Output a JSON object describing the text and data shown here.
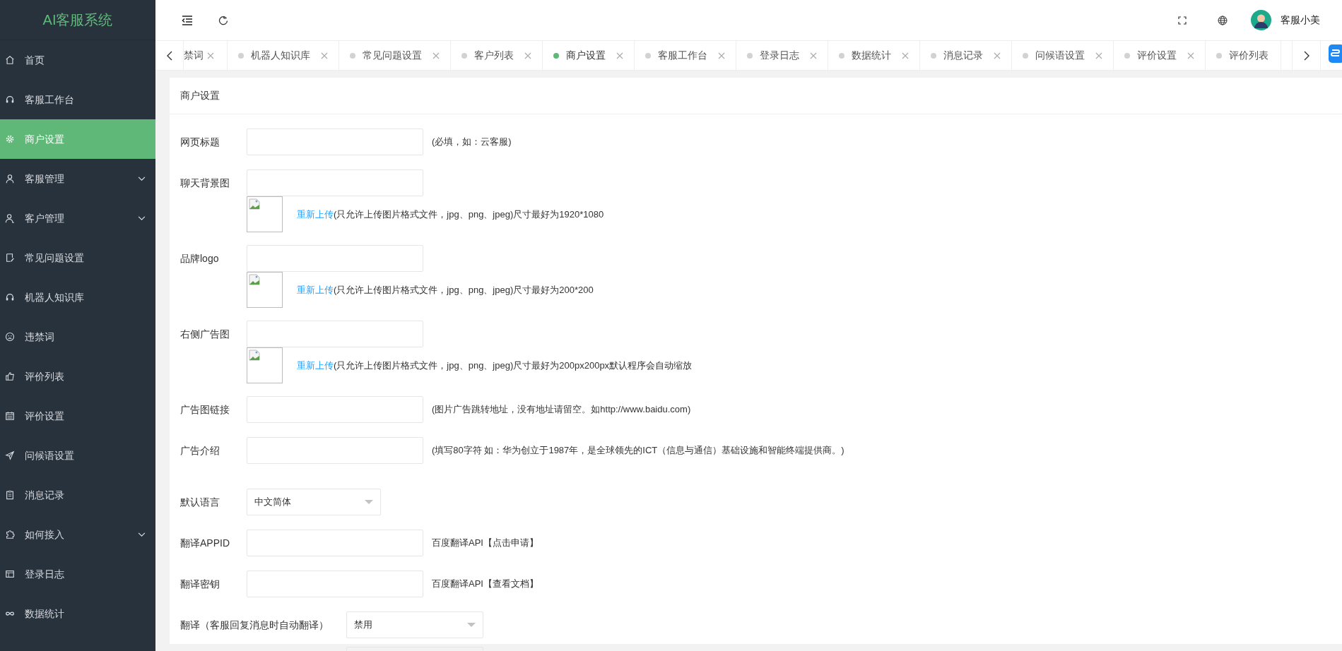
{
  "app_title": "AI客服系统",
  "sidebar": {
    "items": [
      {
        "label": "首页",
        "selected": false,
        "has_submenu": false
      },
      {
        "label": "客服工作台",
        "selected": false,
        "has_submenu": false
      },
      {
        "label": "商户设置",
        "selected": true,
        "has_submenu": false
      },
      {
        "label": "客服管理",
        "selected": false,
        "has_submenu": true
      },
      {
        "label": "客户管理",
        "selected": false,
        "has_submenu": true
      },
      {
        "label": "常见问题设置",
        "selected": false,
        "has_submenu": false
      },
      {
        "label": "机器人知识库",
        "selected": false,
        "has_submenu": false
      },
      {
        "label": "违禁词",
        "selected": false,
        "has_submenu": false
      },
      {
        "label": "评价列表",
        "selected": false,
        "has_submenu": false
      },
      {
        "label": "评价设置",
        "selected": false,
        "has_submenu": false
      },
      {
        "label": "问候语设置",
        "selected": false,
        "has_submenu": false
      },
      {
        "label": "消息记录",
        "selected": false,
        "has_submenu": false
      },
      {
        "label": "如何接入",
        "selected": false,
        "has_submenu": true
      },
      {
        "label": "登录日志",
        "selected": false,
        "has_submenu": false
      },
      {
        "label": "数据统计",
        "selected": false,
        "has_submenu": false
      }
    ]
  },
  "user": {
    "name": "客服小美"
  },
  "tabs": [
    {
      "label": "禁词",
      "selected": false,
      "closable": true,
      "cut": true
    },
    {
      "label": "机器人知识库",
      "selected": false,
      "closable": true,
      "cut": false
    },
    {
      "label": "常见问题设置",
      "selected": false,
      "closable": true,
      "cut": false
    },
    {
      "label": "客户列表",
      "selected": false,
      "closable": true,
      "cut": false
    },
    {
      "label": "商户设置",
      "selected": true,
      "closable": true,
      "cut": false
    },
    {
      "label": "客服工作台",
      "selected": false,
      "closable": true,
      "cut": false
    },
    {
      "label": "登录日志",
      "selected": false,
      "closable": true,
      "cut": false
    },
    {
      "label": "数据统计",
      "selected": false,
      "closable": true,
      "cut": false
    },
    {
      "label": "消息记录",
      "selected": false,
      "closable": true,
      "cut": false
    },
    {
      "label": "问候语设置",
      "selected": false,
      "closable": true,
      "cut": false
    },
    {
      "label": "评价设置",
      "selected": false,
      "closable": true,
      "cut": false
    },
    {
      "label": "评价列表",
      "selected": false,
      "closable": false,
      "cut": false
    }
  ],
  "card": {
    "title": "商户设置"
  },
  "form": [
    {
      "kind": "text",
      "label": "网页标题",
      "hint": "(必填，如：云客服)"
    },
    {
      "kind": "image",
      "label": "聊天背景图",
      "link": "重新上传",
      "note": "(只允许上传图片格式文件，jpg、png、jpeg)尺寸最好为1920*1080"
    },
    {
      "kind": "image",
      "label": "品牌logo",
      "link": "重新上传",
      "note": "(只允许上传图片格式文件，jpg、png、jpeg)尺寸最好为200*200"
    },
    {
      "kind": "image",
      "label": "右侧广告图",
      "link": "重新上传",
      "note": "(只允许上传图片格式文件，jpg、png、jpeg)尺寸最好为200px200px默认程序会自动缩放"
    },
    {
      "kind": "text",
      "label": "广告图链接",
      "hint": "(图片广告跳转地址，没有地址请留空。如http://www.baidu.com)"
    },
    {
      "kind": "text",
      "label": "广告介绍",
      "hint": "(填写80字符 如：华为创立于1987年，是全球领先的ICT（信息与通信）基础设施和智能终端提供商。)"
    },
    {
      "kind": "select",
      "label": "默认语言",
      "value": "中文简体"
    },
    {
      "kind": "text",
      "label": "翻译APPID",
      "hint": "百度翻译API【点击申请】"
    },
    {
      "kind": "text",
      "label": "翻译密钥",
      "hint": "百度翻译API【查看文档】"
    },
    {
      "kind": "select",
      "label": "翻译（客服回复消息时自动翻译）",
      "value": "禁用"
    },
    {
      "kind": "cut"
    }
  ]
}
